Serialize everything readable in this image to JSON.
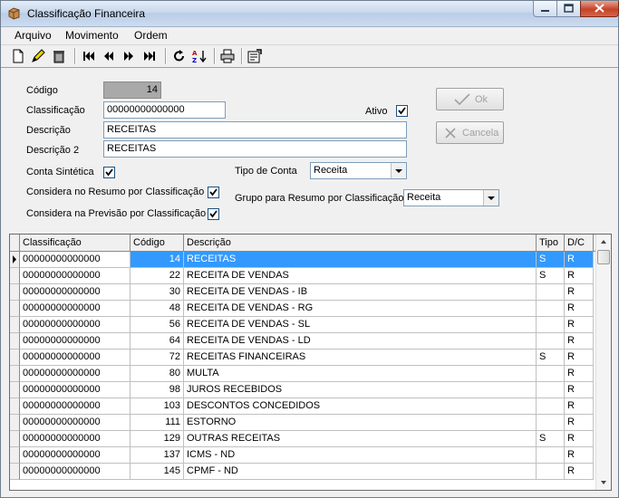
{
  "window": {
    "title": "Classificação Financeira"
  },
  "menu": [
    "Arquivo",
    "Movimento",
    "Ordem"
  ],
  "toolbar_icons": [
    "new-icon",
    "edit-icon",
    "delete-icon",
    "first-record-icon",
    "previous-record-icon",
    "next-record-icon",
    "last-record-icon",
    "refresh-icon",
    "sort-az-icon",
    "print-icon",
    "properties-icon"
  ],
  "form": {
    "codigo_label": "Código",
    "codigo_value": "14",
    "classificacao_label": "Classificação",
    "classificacao_value": "00000000000000",
    "descricao_label": "Descrição",
    "descricao_value": "RECEITAS",
    "descricao2_label": "Descrição 2",
    "descricao2_value": "RECEITAS",
    "ativo_label": "Ativo",
    "ativo_checked": true,
    "conta_sintetica_label": "Conta Sintética",
    "conta_sintetica_checked": true,
    "resumo_label": "Considera no Resumo por Classificação",
    "resumo_checked": true,
    "previsao_label": "Considera na Previsão por Classificação",
    "previsao_checked": true,
    "tipo_conta_label": "Tipo de Conta",
    "tipo_conta_value": "Receita",
    "grupo_label": "Grupo para Resumo por Classificação",
    "grupo_value": "Receita",
    "ok_label": "Ok",
    "cancela_label": "Cancela"
  },
  "grid": {
    "columns": [
      "Classificação",
      "Código",
      "Descrição",
      "Tipo",
      "D/C"
    ],
    "rows": [
      {
        "classificacao": "00000000000000",
        "codigo": "14",
        "descricao": "RECEITAS",
        "tipo": "S",
        "dc": "R"
      },
      {
        "classificacao": "00000000000000",
        "codigo": "22",
        "descricao": "RECEITA DE VENDAS",
        "tipo": "S",
        "dc": "R"
      },
      {
        "classificacao": "00000000000000",
        "codigo": "30",
        "descricao": "RECEITA DE VENDAS - IB",
        "tipo": "",
        "dc": "R"
      },
      {
        "classificacao": "00000000000000",
        "codigo": "48",
        "descricao": "RECEITA DE VENDAS - RG",
        "tipo": "",
        "dc": "R"
      },
      {
        "classificacao": "00000000000000",
        "codigo": "56",
        "descricao": "RECEITA DE VENDAS - SL",
        "tipo": "",
        "dc": "R"
      },
      {
        "classificacao": "00000000000000",
        "codigo": "64",
        "descricao": "RECEITA DE VENDAS - LD",
        "tipo": "",
        "dc": "R"
      },
      {
        "classificacao": "00000000000000",
        "codigo": "72",
        "descricao": "RECEITAS FINANCEIRAS",
        "tipo": "S",
        "dc": "R"
      },
      {
        "classificacao": "00000000000000",
        "codigo": "80",
        "descricao": "MULTA",
        "tipo": "",
        "dc": "R"
      },
      {
        "classificacao": "00000000000000",
        "codigo": "98",
        "descricao": "JUROS RECEBIDOS",
        "tipo": "",
        "dc": "R"
      },
      {
        "classificacao": "00000000000000",
        "codigo": "103",
        "descricao": "DESCONTOS CONCEDIDOS",
        "tipo": "",
        "dc": "R"
      },
      {
        "classificacao": "00000000000000",
        "codigo": "111",
        "descricao": "ESTORNO",
        "tipo": "",
        "dc": "R"
      },
      {
        "classificacao": "00000000000000",
        "codigo": "129",
        "descricao": "OUTRAS RECEITAS",
        "tipo": "S",
        "dc": "R"
      },
      {
        "classificacao": "00000000000000",
        "codigo": "137",
        "descricao": "ICMS - ND",
        "tipo": "",
        "dc": "R"
      },
      {
        "classificacao": "00000000000000",
        "codigo": "145",
        "descricao": "CPMF - ND",
        "tipo": "",
        "dc": "R"
      }
    ],
    "selected_index": 0
  }
}
